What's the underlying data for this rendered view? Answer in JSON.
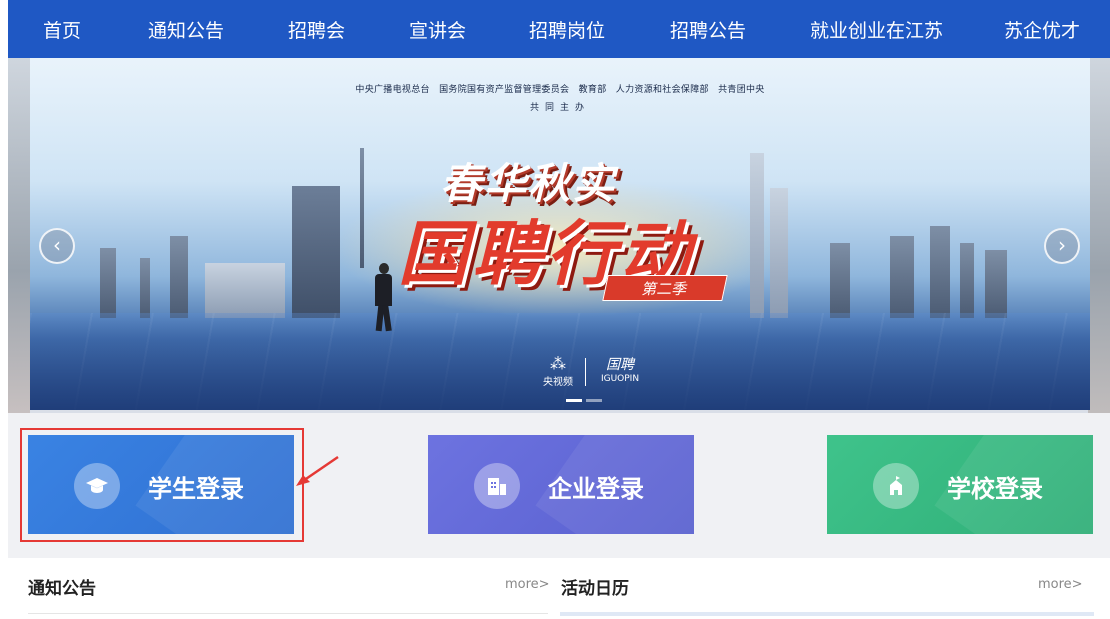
{
  "nav": {
    "items": [
      "首页",
      "通知公告",
      "招聘会",
      "宣讲会",
      "招聘岗位",
      "招聘公告",
      "就业创业在江苏",
      "苏企优才"
    ]
  },
  "banner": {
    "organizers": "中央广播电视总台　国务院国有资产监督管理委员会　教育部　人力资源和社会保障部　共青团中央",
    "organizers_line2": "共同主办",
    "title_line1": "春华秋实",
    "title_line2": "国聘行动",
    "season": "第二季",
    "logo_left_mark": "⁂",
    "logo_left": "央视频",
    "logo_right_mark": "国聘",
    "logo_right": "IGUOPIN",
    "prev_arrow": "‹",
    "next_arrow": "›",
    "slides_total": 2,
    "slide_active": 1
  },
  "login": {
    "student": "学生登录",
    "company": "企业登录",
    "school": "学校登录",
    "colors": {
      "student": "#3a83e3",
      "company": "#6d73e0",
      "school": "#3fc38b",
      "highlight": "#e53935"
    },
    "icons": {
      "student": "graduation-cap-icon",
      "company": "building-icon",
      "school": "school-icon"
    }
  },
  "sections": {
    "notices_title": "通知公告",
    "notices_more": "more>",
    "calendar_title": "活动日历",
    "calendar_more": "more>"
  },
  "colors": {
    "nav_bg": "#1f58c4"
  }
}
